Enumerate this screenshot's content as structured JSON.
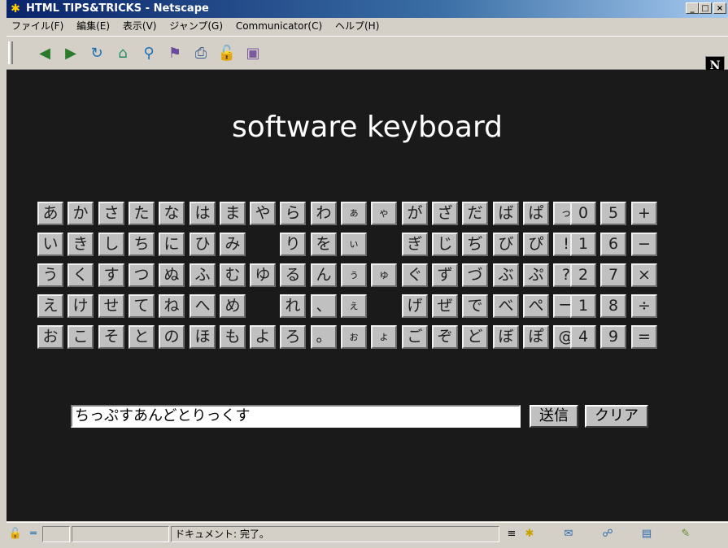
{
  "window": {
    "title": "HTML TIPS&TRICKS - Netscape"
  },
  "menu": [
    "ファイル(F)",
    "編集(E)",
    "表示(V)",
    "ジャンプ(G)",
    "Communicator(C)",
    "ヘルプ(H)"
  ],
  "page": {
    "heading": "software keyboard",
    "kana_rows": [
      [
        "あ",
        "か",
        "さ",
        "た",
        "な",
        "は",
        "ま",
        "や",
        "ら",
        "わ",
        "ぁ",
        "ゃ",
        "が",
        "ざ",
        "だ",
        "ば",
        "ぱ",
        "っ"
      ],
      [
        "い",
        "き",
        "し",
        "ち",
        "に",
        "ひ",
        "み",
        "",
        "り",
        "を",
        "ぃ",
        "",
        "ぎ",
        "じ",
        "ぢ",
        "び",
        "ぴ",
        "!"
      ],
      [
        "う",
        "く",
        "す",
        "つ",
        "ぬ",
        "ふ",
        "む",
        "ゆ",
        "る",
        "ん",
        "ぅ",
        "ゅ",
        "ぐ",
        "ず",
        "づ",
        "ぶ",
        "ぷ",
        "?"
      ],
      [
        "え",
        "け",
        "せ",
        "て",
        "ね",
        "へ",
        "め",
        "",
        "れ",
        "、",
        "ぇ",
        "",
        "げ",
        "ぜ",
        "で",
        "べ",
        "ぺ",
        "ー"
      ],
      [
        "お",
        "こ",
        "そ",
        "と",
        "の",
        "ほ",
        "も",
        "よ",
        "ろ",
        "。",
        "ぉ",
        "ょ",
        "ご",
        "ぞ",
        "ど",
        "ぼ",
        "ぽ",
        "@"
      ]
    ],
    "num_rows": [
      [
        "0",
        "5",
        "+"
      ],
      [
        "1",
        "6",
        "−"
      ],
      [
        "2",
        "7",
        "×"
      ],
      [
        "1",
        "8",
        "÷"
      ],
      [
        "4",
        "9",
        "="
      ]
    ],
    "input_value": "ちっぷすあんどとりっくす",
    "submit_label": "送信",
    "clear_label": "クリア"
  },
  "status": {
    "text": "ドキュメント: 完了。"
  },
  "colors": {
    "background": "#1a1a1a",
    "key": "#c0c0c0",
    "heading": "#ffffff"
  }
}
